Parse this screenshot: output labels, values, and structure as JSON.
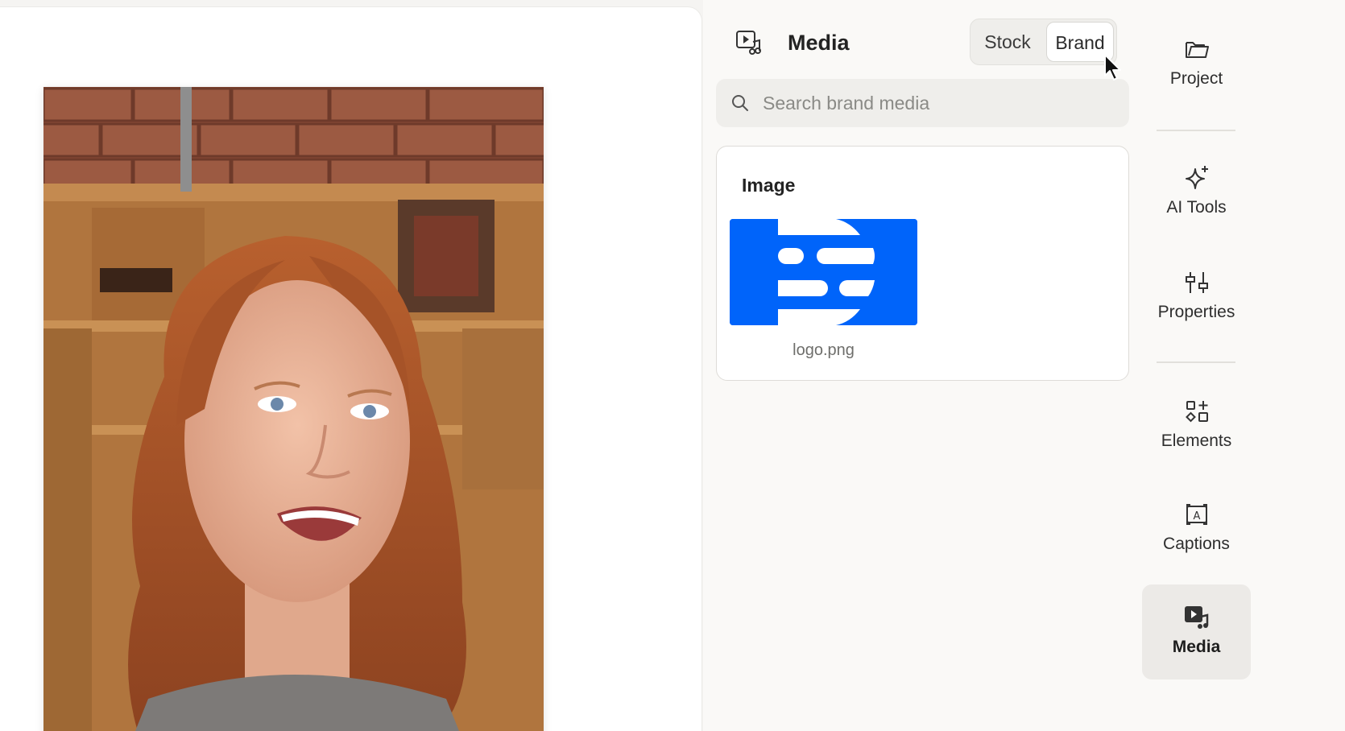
{
  "panel": {
    "title": "Media",
    "tabs": [
      {
        "label": "Stock",
        "selected": false
      },
      {
        "label": "Brand",
        "selected": true
      }
    ],
    "search": {
      "placeholder": "Search brand media",
      "value": ""
    },
    "section": {
      "title": "Image",
      "items": [
        {
          "filename": "logo.png",
          "thumb_color": "#0064fa"
        }
      ]
    }
  },
  "nav": {
    "items": [
      {
        "label": "Project",
        "icon": "folder-open-icon",
        "active": false
      },
      {
        "label": "AI Tools",
        "icon": "sparkles-icon",
        "active": false
      },
      {
        "label": "Properties",
        "icon": "sliders-icon",
        "active": false
      },
      {
        "label": "Elements",
        "icon": "shapes-icon",
        "active": false
      },
      {
        "label": "Captions",
        "icon": "captions-icon",
        "active": false
      },
      {
        "label": "Media",
        "icon": "media-icon",
        "active": true
      }
    ]
  },
  "colors": {
    "accent": "#0064fa",
    "panel_bg": "#faf9f7",
    "active_nav_bg": "#eceae7"
  }
}
